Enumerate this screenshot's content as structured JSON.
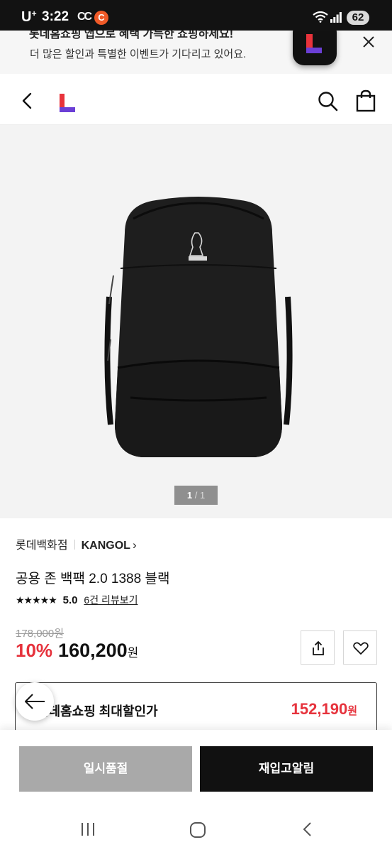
{
  "status_bar": {
    "carrier": "U",
    "carrier_sup": "+",
    "time": "3:22",
    "cc_label": "CC",
    "app_badge": "C",
    "battery": "62"
  },
  "app_banner": {
    "title": "롯데홈쇼핑 앱으로 혜택 가득한 쇼핑하세요!",
    "subtitle": "더 많은 할인과 특별한 이벤트가 기다리고 있어요."
  },
  "product": {
    "image_indicator": {
      "current": "1",
      "separator": "/",
      "total": "1"
    },
    "store": "롯데백화점",
    "brand": "KANGOL",
    "brand_chevron": "›",
    "name": "공용 존 백팩 2.0 1388 블랙",
    "stars": "★★★★★",
    "rating": "5.0",
    "review_link": "6건 리뷰보기",
    "original_price": "178,000원",
    "discount": "10%",
    "price": "160,200",
    "won": "원"
  },
  "max_discount": {
    "label": "롯데홈쇼핑 최대할인가",
    "value": "152,190",
    "won": "원"
  },
  "actions": {
    "soldout_label": "일시품절",
    "restock_label": "재입고알림"
  },
  "colors": {
    "accent_red": "#e6323c",
    "logo_red": "#e8333b",
    "logo_purple": "#6b3fd6",
    "soldout_gray": "#a9a9a9",
    "dark": "#111111"
  },
  "icons": [
    "wifi-icon",
    "signal-icon",
    "close-icon",
    "back-icon",
    "logo-icon",
    "search-icon",
    "shopping-bag-icon",
    "share-icon",
    "wishlist-heart-icon",
    "arrow-left-icon",
    "recent-apps-icon",
    "home-icon",
    "nav-back-icon"
  ]
}
